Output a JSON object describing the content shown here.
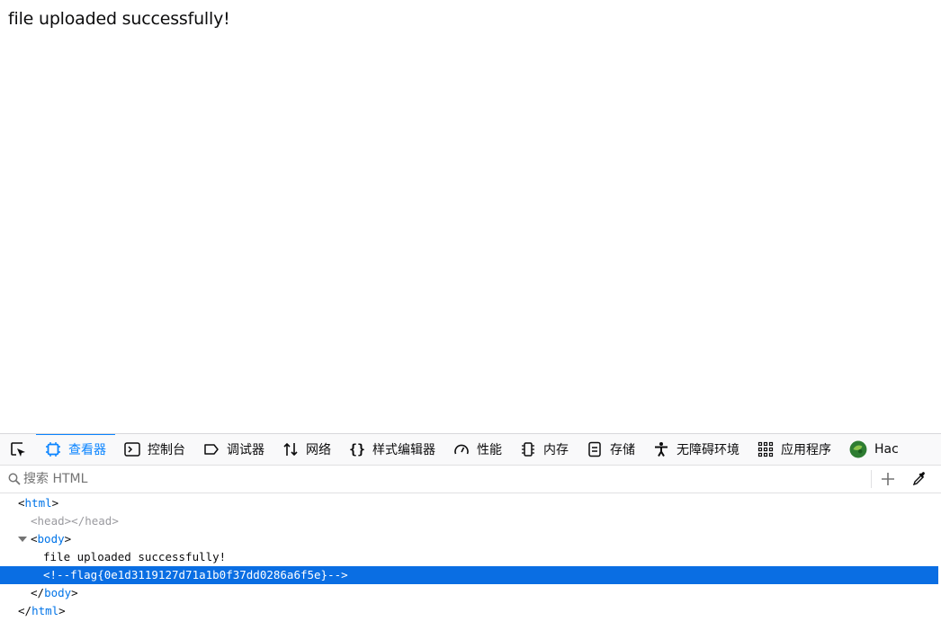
{
  "page": {
    "message": "file uploaded successfully!"
  },
  "devtools": {
    "tabs": [
      {
        "label": "查看器",
        "icon": "inspector-icon",
        "active": true
      },
      {
        "label": "控制台",
        "icon": "console-icon"
      },
      {
        "label": "调试器",
        "icon": "debugger-icon"
      },
      {
        "label": "网络",
        "icon": "network-icon"
      },
      {
        "label": "样式编辑器",
        "icon": "style-editor-icon"
      },
      {
        "label": "性能",
        "icon": "performance-icon"
      },
      {
        "label": "内存",
        "icon": "memory-icon"
      },
      {
        "label": "存储",
        "icon": "storage-icon"
      },
      {
        "label": "无障碍环境",
        "icon": "accessibility-icon"
      },
      {
        "label": "应用程序",
        "icon": "application-icon"
      },
      {
        "label": "Hac",
        "icon": "hackbar-icon"
      }
    ],
    "search": {
      "placeholder": "搜索 HTML",
      "value": ""
    },
    "tree": {
      "html_open_tag": "html",
      "head_tag": "head",
      "body_open_tag": "body",
      "text_node": "file uploaded successfully!",
      "comment": "<!--flag{0e1d3119127d71a1b0f37dd0286a6f5e}-->",
      "body_close_tag": "body",
      "html_close_tag": "html"
    },
    "colors": {
      "accent": "#0a84ff",
      "selection": "#0a6ee3",
      "tag": "#0074e8"
    }
  }
}
